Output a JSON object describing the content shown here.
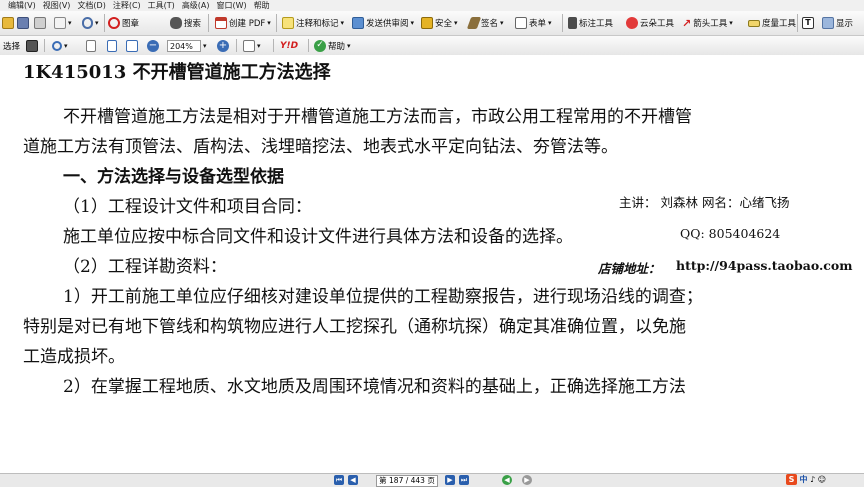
{
  "menu": [
    "编辑(V)",
    "视图(V)",
    "文档(D)",
    "注释(C)",
    "工具(T)",
    "高级(A)",
    "窗口(W)",
    "帮助"
  ],
  "toolbar1": {
    "view_label": "图章",
    "search_label": "搜索",
    "create_pdf_label": "创建 PDF",
    "comment_label": "注释和标记",
    "send_review_label": "发送供审阅",
    "security_label": "安全",
    "sign_label": "签名",
    "form_label": "表单",
    "mark_tool_label": "标注工具",
    "cloud_tool_label": "云朵工具",
    "arrow_tool_label": "箭头工具",
    "measure_tool_label": "度量工具",
    "show_label": "显示"
  },
  "toolbar2": {
    "select_label": "选择",
    "zoom_value": "204%",
    "help_label": "帮助"
  },
  "document": {
    "heading": "1K415013   不开槽管道施工方法选择",
    "para1_line1": "不开槽管道施工方法是相对于开槽管道施工方法而言，市政公用工程常用的不开槽管",
    "para1_line2": "道施工方法有顶管法、盾构法、浅埋暗挖法、地表式水平定向钻法、夯管法等。",
    "section1": "一、方法选择与设备选型依据",
    "item1": "（1）工程设计文件和项目合同：",
    "item1_body": "施工单位应按中标合同文件和设计文件进行具体方法和设备的选择。",
    "item2": "（2）工程详勘资料：",
    "item2_sub1_line1": "1）开工前施工单位应仔细核对建设单位提供的工程勘察报告，进行现场沿线的调查；",
    "item2_sub1_line2": "特别是对已有地下管线和构筑物应进行人工挖探孔（通称坑探）确定其准确位置，以免施",
    "item2_sub1_line3": "工造成损坏。",
    "item2_sub2_line1": "2）在掌握工程地质、水文地质及周围环境情况和资料的基础上，正确选择施工方法"
  },
  "watermark": {
    "lecturer": "主讲：   刘森林    网名：心绪飞扬",
    "qq": "QQ: 805404624",
    "shop_label": "店铺地址：",
    "shop_url": "http://94pass.taobao.com"
  },
  "statusbar": {
    "page_indicator": "第 187 / 443 页"
  },
  "colors": {
    "watermark_red": "#d8102a",
    "toolbar_bg": "#ececec"
  }
}
